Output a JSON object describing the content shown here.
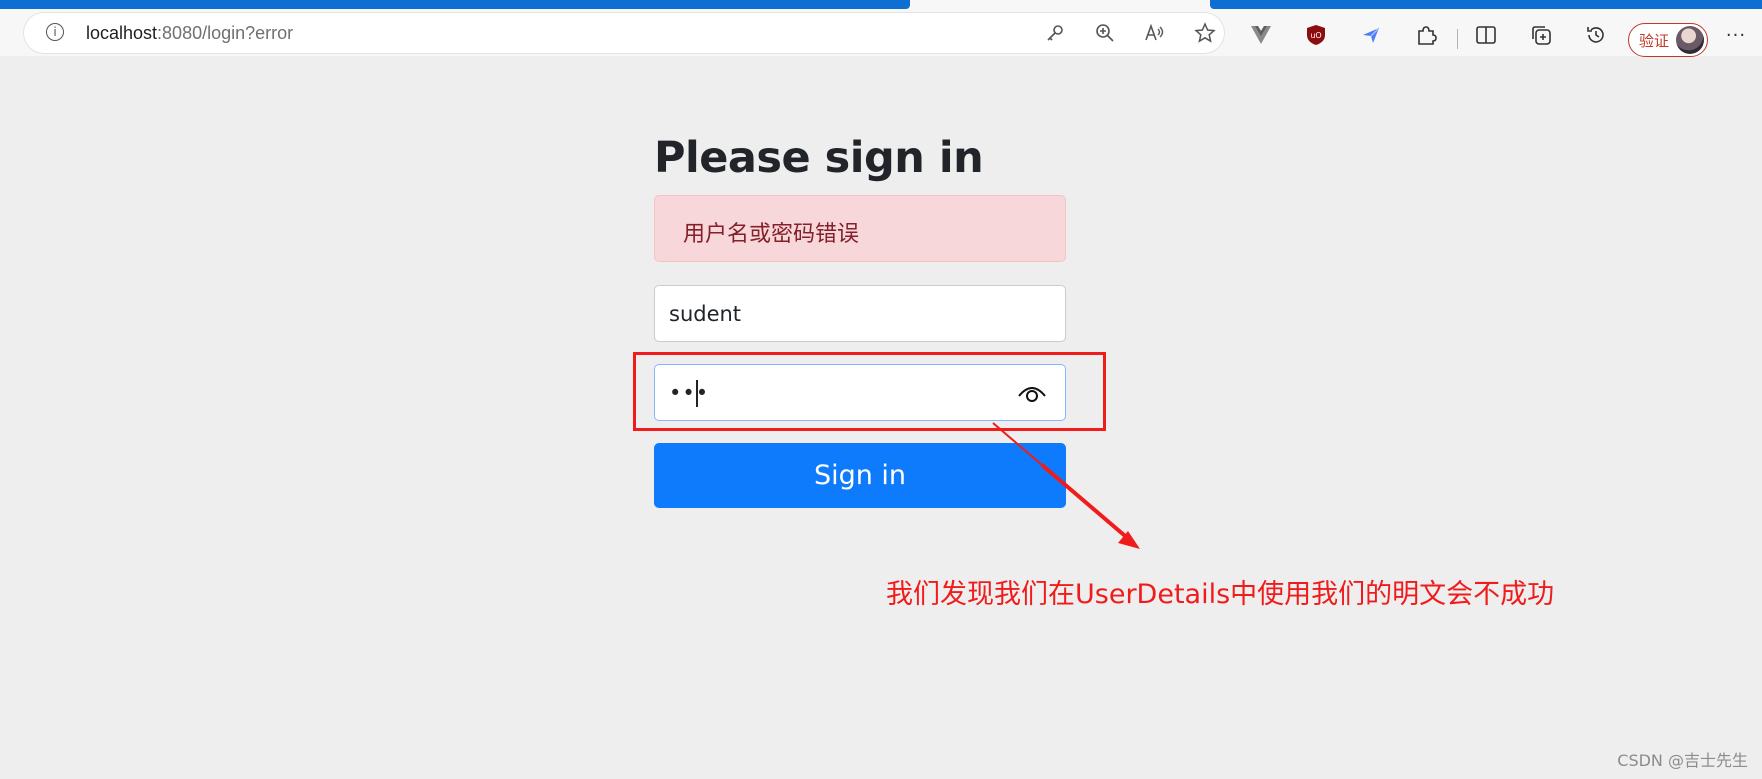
{
  "browser": {
    "url_host": "localhost",
    "url_rest": ":8080/login?error",
    "verify_label": "验证",
    "menu_glyph": "···"
  },
  "page": {
    "title": "Please sign in",
    "error_message": "用户名或密码错误",
    "username_value": "sudent",
    "password_mask": "•••",
    "submit_label": "Sign in"
  },
  "annotation": {
    "text": "我们发现我们在UserDetails中使用我们的明文会不成功",
    "color": "#f01c1c"
  },
  "watermark": "CSDN @吉士先生",
  "colors": {
    "primary": "#0d7bfc",
    "alert_bg": "#f8d7da",
    "alert_text": "#842029",
    "tab_blue": "#0c6fd1"
  }
}
